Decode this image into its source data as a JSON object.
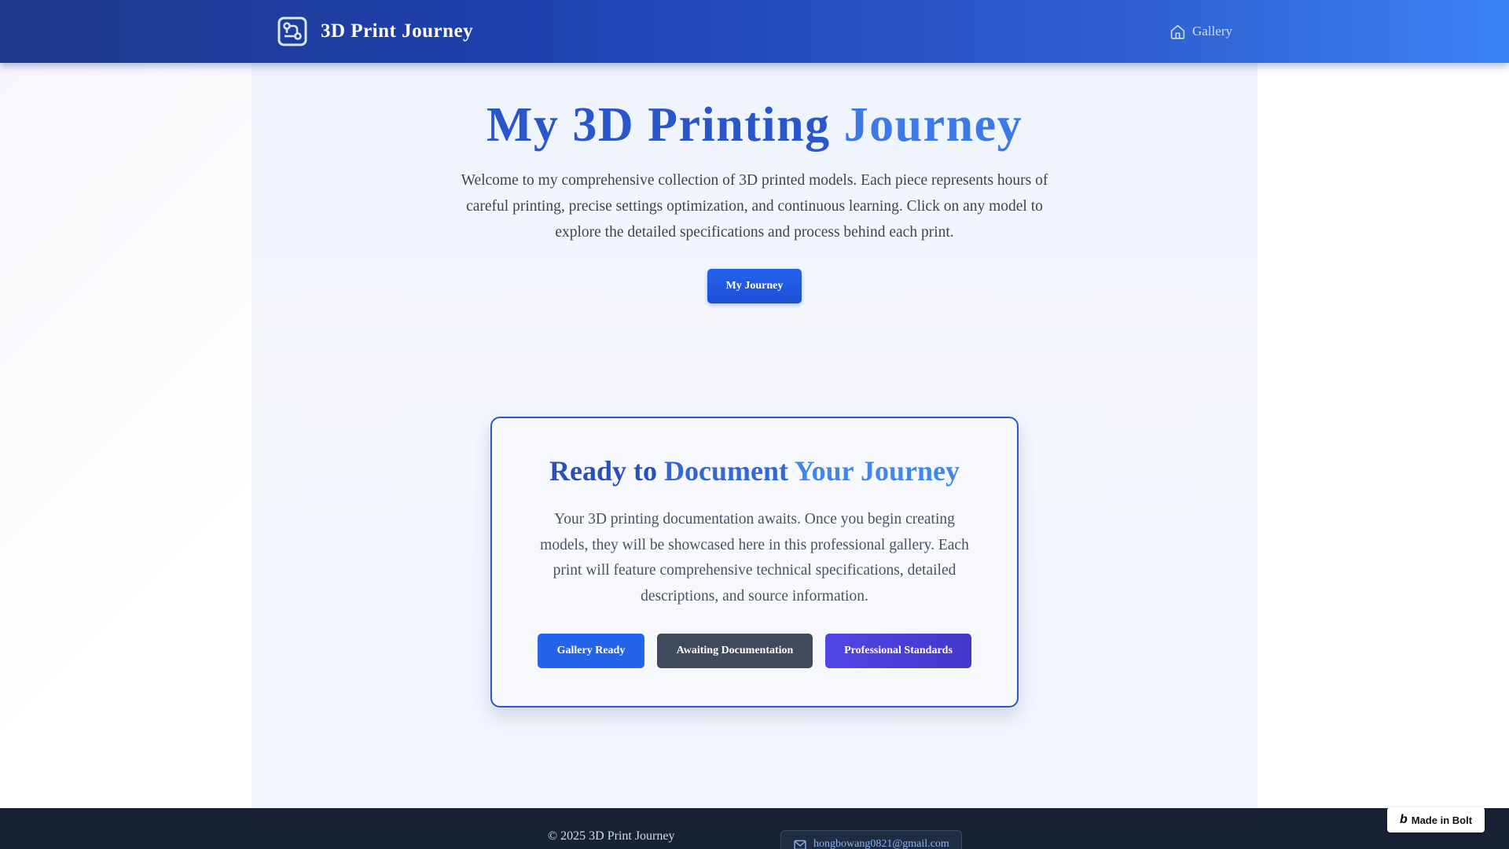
{
  "header": {
    "brand_title": "3D Print Journey",
    "brand_icon": "circuit-board-icon",
    "nav_gallery_label": "Gallery",
    "nav_gallery_icon": "home-icon"
  },
  "hero": {
    "title_part1": "My 3D Printing",
    "title_part2": "Journey",
    "description": "Welcome to my comprehensive collection of 3D printed models. Each piece represents hours of careful printing, precise settings optimization, and continuous learning. Click on any model to explore the detailed specifications and process behind each print.",
    "button_label": "My Journey"
  },
  "card": {
    "title_part1": "Ready to",
    "title_part2": "Document",
    "title_part3": "Your Journey",
    "description": "Your 3D printing documentation awaits. Once you begin creating models, they will be showcased here in this professional gallery. Each print will feature comprehensive technical specifications, detailed descriptions, and source information.",
    "buttons": [
      {
        "label": "Gallery Ready"
      },
      {
        "label": "Awaiting Documentation"
      },
      {
        "label": "Professional Standards"
      }
    ]
  },
  "footer": {
    "copyright": "© 2025 3D Print Journey",
    "email": "hongbowang0821@gmail.com",
    "email_icon": "mail-icon"
  },
  "badge": {
    "label": "Made in Bolt",
    "logo": "b"
  },
  "colors": {
    "header_start": "#1e3a8a",
    "header_end": "#3b82f6",
    "primary_blue": "#2563eb",
    "slate": "#3f4a5c",
    "indigo": "#4f46e5",
    "footer_bg": "#172235"
  }
}
